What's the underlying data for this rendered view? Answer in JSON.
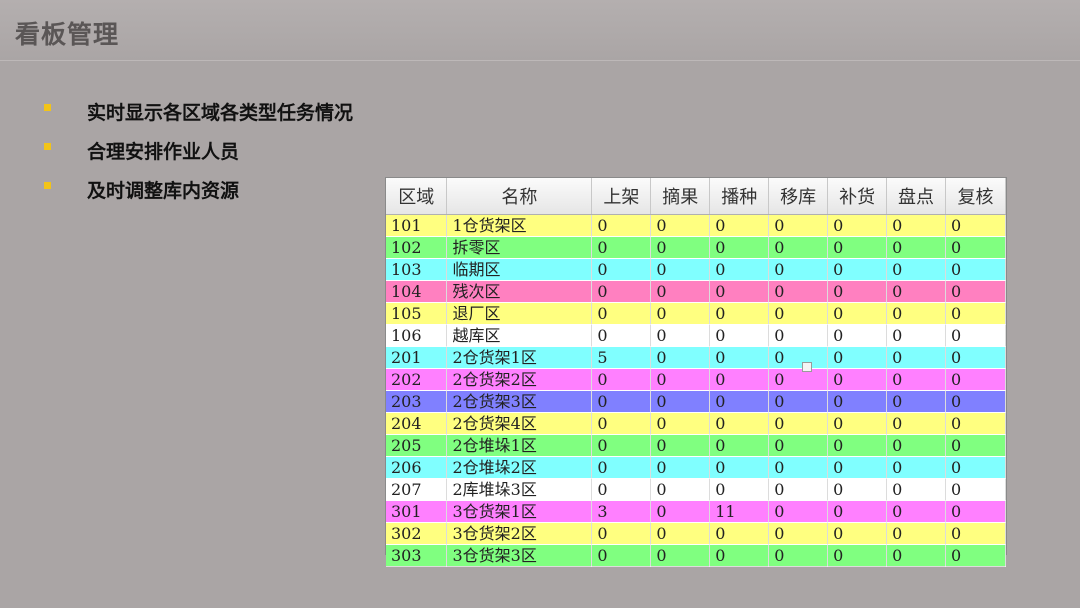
{
  "header": {
    "title": "看板管理"
  },
  "bullets": [
    "实时显示各区域各类型任务情况",
    "合理安排作业人员",
    "及时调整库内资源"
  ],
  "table": {
    "headers": [
      "区域",
      "名称",
      "上架",
      "摘果",
      "播种",
      "移库",
      "补货",
      "盘点",
      "复核"
    ],
    "rows": [
      {
        "color": "#ffff80",
        "cells": [
          "101",
          "1仓货架区",
          "0",
          "0",
          "0",
          "0",
          "0",
          "0",
          "0"
        ]
      },
      {
        "color": "#80ff80",
        "cells": [
          "102",
          "拆零区",
          "0",
          "0",
          "0",
          "0",
          "0",
          "0",
          "0"
        ]
      },
      {
        "color": "#80ffff",
        "cells": [
          "103",
          "临期区",
          "0",
          "0",
          "0",
          "0",
          "0",
          "0",
          "0"
        ]
      },
      {
        "color": "#ff80c0",
        "cells": [
          "104",
          "残次区",
          "0",
          "0",
          "0",
          "0",
          "0",
          "0",
          "0"
        ]
      },
      {
        "color": "#ffff80",
        "cells": [
          "105",
          "退厂区",
          "0",
          "0",
          "0",
          "0",
          "0",
          "0",
          "0"
        ]
      },
      {
        "color": "#ffffff",
        "cells": [
          "106",
          "越库区",
          "0",
          "0",
          "0",
          "0",
          "0",
          "0",
          "0"
        ]
      },
      {
        "color": "#80ffff",
        "cells": [
          "201",
          "2仓货架1区",
          "5",
          "0",
          "0",
          "0",
          "0",
          "0",
          "0"
        ]
      },
      {
        "color": "#ff80ff",
        "cells": [
          "202",
          "2仓货架2区",
          "0",
          "0",
          "0",
          "0",
          "0",
          "0",
          "0"
        ]
      },
      {
        "color": "#8080ff",
        "cells": [
          "203",
          "2仓货架3区",
          "0",
          "0",
          "0",
          "0",
          "0",
          "0",
          "0"
        ]
      },
      {
        "color": "#ffff80",
        "cells": [
          "204",
          "2仓货架4区",
          "0",
          "0",
          "0",
          "0",
          "0",
          "0",
          "0"
        ]
      },
      {
        "color": "#80ff80",
        "cells": [
          "205",
          "2仓堆垛1区",
          "0",
          "0",
          "0",
          "0",
          "0",
          "0",
          "0"
        ]
      },
      {
        "color": "#80ffff",
        "cells": [
          "206",
          "2仓堆垛2区",
          "0",
          "0",
          "0",
          "0",
          "0",
          "0",
          "0"
        ]
      },
      {
        "color": "#ffffff",
        "cells": [
          "207",
          "2库堆垛3区",
          "0",
          "0",
          "0",
          "0",
          "0",
          "0",
          "0"
        ]
      },
      {
        "color": "#ff80ff",
        "cells": [
          "301",
          "3仓货架1区",
          "3",
          "0",
          "11",
          "0",
          "0",
          "0",
          "0"
        ]
      },
      {
        "color": "#ffff80",
        "cells": [
          "302",
          "3仓货架2区",
          "0",
          "0",
          "0",
          "0",
          "0",
          "0",
          "0"
        ]
      },
      {
        "color": "#80ff80",
        "cells": [
          "303",
          "3仓货架3区",
          "0",
          "0",
          "0",
          "0",
          "0",
          "0",
          "0"
        ]
      }
    ]
  }
}
